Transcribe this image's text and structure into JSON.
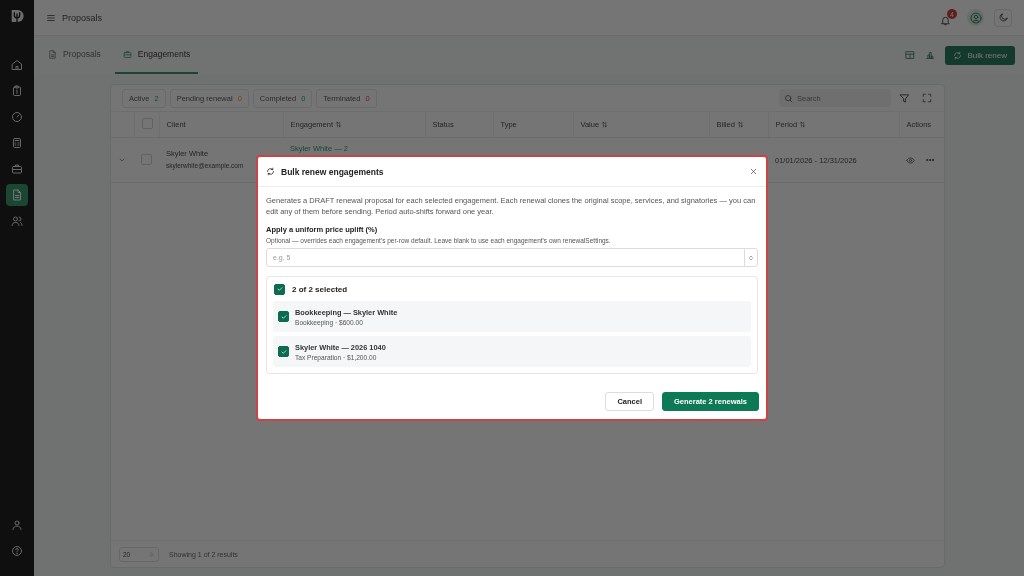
{
  "sidebar": {
    "items": [
      {
        "kind": "home",
        "selected": false
      },
      {
        "kind": "clipboard",
        "selected": false
      },
      {
        "kind": "gauge",
        "selected": false
      },
      {
        "kind": "calculator",
        "selected": false
      },
      {
        "kind": "briefcase",
        "selected": false
      },
      {
        "kind": "document",
        "selected": true
      },
      {
        "kind": "people",
        "selected": false
      }
    ],
    "bottom_items": [
      {
        "kind": "user",
        "selected": false
      },
      {
        "kind": "help",
        "selected": false
      }
    ]
  },
  "app_bar": {
    "title": "Proposals",
    "notification_count": "4"
  },
  "tabs": [
    {
      "label": "Proposals",
      "kind": "document",
      "selected": false
    },
    {
      "label": "Engagements",
      "kind": "briefcase",
      "selected": true
    }
  ],
  "toolbar": {
    "bulk_renew": "Bulk renew"
  },
  "status_filters": [
    {
      "label": "Active",
      "count": "2",
      "kind": "success"
    },
    {
      "label": "Pending renewal",
      "count": "0",
      "kind": "warning"
    },
    {
      "label": "Completed",
      "count": "0",
      "kind": "success"
    },
    {
      "label": "Terminated",
      "count": "0",
      "kind": "danger"
    }
  ],
  "search": {
    "placeholder": "Search"
  },
  "table": {
    "select_all_checked": false,
    "columns": [
      {
        "label": "Client",
        "sortable": false
      },
      {
        "label": "Engagement",
        "sortable": true
      },
      {
        "label": "Status",
        "sortable": false
      },
      {
        "label": "Type",
        "sortable": false
      },
      {
        "label": "Value",
        "sortable": true
      },
      {
        "label": "Billed",
        "sortable": true
      },
      {
        "label": "Period",
        "sortable": true
      },
      {
        "label": "Actions",
        "sortable": false
      }
    ],
    "rows": [
      {
        "client": "Skyler White",
        "email": "skylerwhite@example.com",
        "engagement": "Skyler White — 2",
        "period": "01/01/2026 - 12/31/2026",
        "checked": false
      }
    ]
  },
  "pagination": {
    "page_size": "20",
    "summary": "Showing 1 of 2 results"
  },
  "modal": {
    "title": "Bulk renew engagements",
    "description": "Generates a DRAFT renewal proposal for each selected engagement. Each renewal clones the original scope, services, and signatories — you can edit any of them before sending. Period auto-shifts forward one year.",
    "uplift_label": "Apply a uniform price uplift (%)",
    "uplift_hint": "Optional — overrides each engagement's per-row default. Leave blank to use each engagement's own renewalSettings.",
    "uplift_placeholder": "e.g. 5",
    "select_all": {
      "label": "2 of 2 selected",
      "checked": true
    },
    "items": [
      {
        "title": "Bookkeeping — Skyler White",
        "subtitle": "Bookkeeping · $600.00",
        "checked": true
      },
      {
        "title": "Skyler White — 2026 1040",
        "subtitle": "Tax Preparation · $1,200.00",
        "checked": true
      }
    ],
    "buttons": [
      {
        "label": "Cancel",
        "kind": "secondary"
      },
      {
        "label": "Generate 2 renewals",
        "kind": "primary"
      }
    ]
  }
}
